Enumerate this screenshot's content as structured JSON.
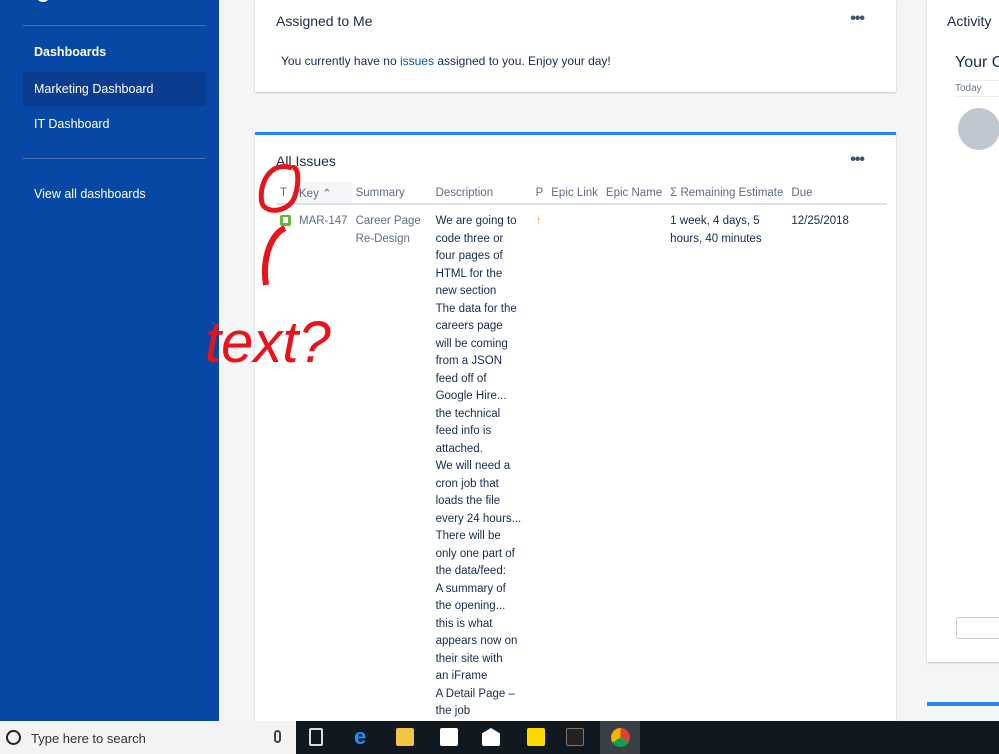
{
  "sidebar": {
    "section": "Dashboards",
    "items": [
      "Marketing Dashboard",
      "IT Dashboard"
    ],
    "view_all": "View all dashboards"
  },
  "assigned": {
    "title": "Assigned to Me",
    "more": "•••",
    "msg_pre": "You currently have no ",
    "msg_link": "issues",
    "msg_post": " assigned to you. Enjoy your day!"
  },
  "issues": {
    "title": "All Issues",
    "more": "•••",
    "columns": [
      "T",
      "Key",
      "Summary",
      "Description",
      "P",
      "Epic Link",
      "Epic Name",
      "Σ Remaining Estimate",
      "Due"
    ],
    "rows": [
      {
        "type": "story-icon",
        "key": "MAR-147",
        "summary": "Career Page Re-Design",
        "description": [
          "We are going to",
          "code three or",
          "four pages of",
          "HTML for the",
          "new section",
          "The data for the",
          "careers page",
          "will be coming",
          "from a JSON",
          "feed off of",
          "Google Hire...",
          "the technical",
          "feed info is",
          "attached.",
          "We will need a",
          "cron job that",
          "loads the file",
          "every 24 hours...",
          "There will be",
          "only one part of",
          "the data/feed:",
          "A summary of",
          "the opening...",
          "this is what",
          "appears now on",
          "their site with",
          "an iFrame",
          "A Detail Page –",
          "the job"
        ],
        "priority": "↑",
        "remaining": "1 week, 4 days, 5 hours, 40 minutes",
        "due": "12/25/2018"
      }
    ]
  },
  "activity": {
    "title": "Activity",
    "stream": "Your C",
    "today": "Today"
  },
  "annotation": {
    "text": "text?"
  },
  "taskbar": {
    "search_placeholder": "Type here to search"
  }
}
